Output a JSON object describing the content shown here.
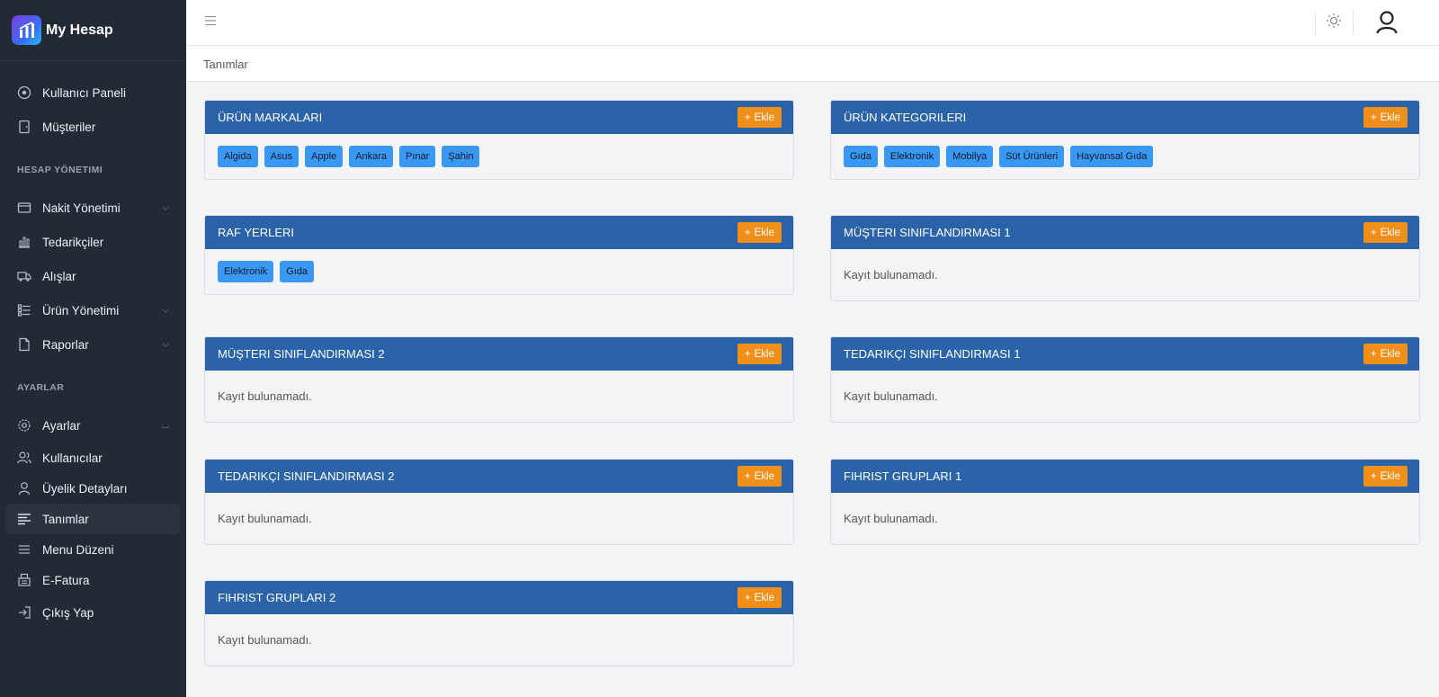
{
  "brand": {
    "name": "My Hesap"
  },
  "sidebar": {
    "top_items": [
      {
        "label": "Kullanıcı Paneli",
        "icon": "dashboard-icon"
      },
      {
        "label": "Müşteriler",
        "icon": "customers-icon"
      }
    ],
    "section1": "HESAP YÖNETIMI",
    "account_items": [
      {
        "label": "Nakit Yönetimi",
        "icon": "cash-icon"
      },
      {
        "label": "Tedarikçiler",
        "icon": "suppliers-icon"
      },
      {
        "label": "Alışlar",
        "icon": "truck-icon"
      },
      {
        "label": "Ürün Yönetimi",
        "icon": "product-list-icon"
      },
      {
        "label": "Raporlar",
        "icon": "report-icon"
      }
    ],
    "section2": "AYARLAR",
    "settings_items": [
      {
        "label": "Ayarlar",
        "icon": "gear-icon"
      },
      {
        "label": "Kullanıcılar",
        "icon": "users-icon"
      },
      {
        "label": "Üyelik Detayları",
        "icon": "user-icon"
      },
      {
        "label": "Tanımlar",
        "icon": "definitions-icon"
      },
      {
        "label": "Menu Düzeni",
        "icon": "menu-icon"
      },
      {
        "label": "E-Fatura",
        "icon": "invoice-icon"
      },
      {
        "label": "Çıkış Yap",
        "icon": "logout-icon"
      }
    ]
  },
  "breadcrumb": "Tanımlar",
  "add_label": "Ekle",
  "empty_text": "Kayıt bulunamadı.",
  "cards": [
    {
      "title": "ÜRÜN MARKALARI",
      "tags": [
        "Algida",
        "Asus",
        "Apple",
        "Ankara",
        "Pınar",
        "Şahin"
      ]
    },
    {
      "title": "ÜRÜN KATEGORILERI",
      "tags": [
        "Gıda",
        "Elektronik",
        "Mobilya",
        "Süt Ürünleri",
        "Hayvansal Gıda"
      ]
    },
    {
      "title": "RAF YERLERI",
      "tags": [
        "Elektronik",
        "Gıda"
      ]
    },
    {
      "title": "MÜŞTERI SINIFLANDIRMASI 1",
      "tags": []
    },
    {
      "title": "MÜŞTERI SINIFLANDIRMASI 2",
      "tags": []
    },
    {
      "title": "TEDARIKÇI SINIFLANDIRMASI 1",
      "tags": []
    },
    {
      "title": "TEDARIKÇI SINIFLANDIRMASI 2",
      "tags": []
    },
    {
      "title": "FIHRIST GRUPLARI 1",
      "tags": []
    },
    {
      "title": "FIHRIST GRUPLARI 2",
      "tags": []
    }
  ]
}
